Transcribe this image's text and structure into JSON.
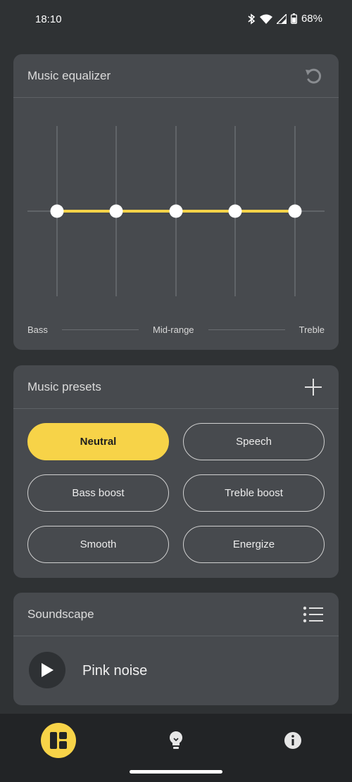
{
  "status_bar": {
    "time": "18:10",
    "battery": "68%",
    "icons": [
      "bluetooth-icon",
      "wifi-icon",
      "signal-icon",
      "battery-icon"
    ]
  },
  "equalizer": {
    "title": "Music equalizer",
    "reset_icon": "reset-icon",
    "bands": [
      0,
      0,
      0,
      0,
      0
    ],
    "labels": {
      "bass": "Bass",
      "mid": "Mid-range",
      "treble": "Treble"
    },
    "accent_color": "#f7d348"
  },
  "presets": {
    "title": "Music presets",
    "add_icon": "plus-icon",
    "items": [
      {
        "label": "Neutral",
        "active": true
      },
      {
        "label": "Speech",
        "active": false
      },
      {
        "label": "Bass boost",
        "active": false
      },
      {
        "label": "Treble boost",
        "active": false
      },
      {
        "label": "Smooth",
        "active": false
      },
      {
        "label": "Energize",
        "active": false
      }
    ]
  },
  "soundscape": {
    "title": "Soundscape",
    "list_icon": "list-icon",
    "track": "Pink noise"
  },
  "nav": {
    "items": [
      "dashboard-icon",
      "lightbulb-icon",
      "info-icon"
    ],
    "active": "dashboard-icon"
  }
}
